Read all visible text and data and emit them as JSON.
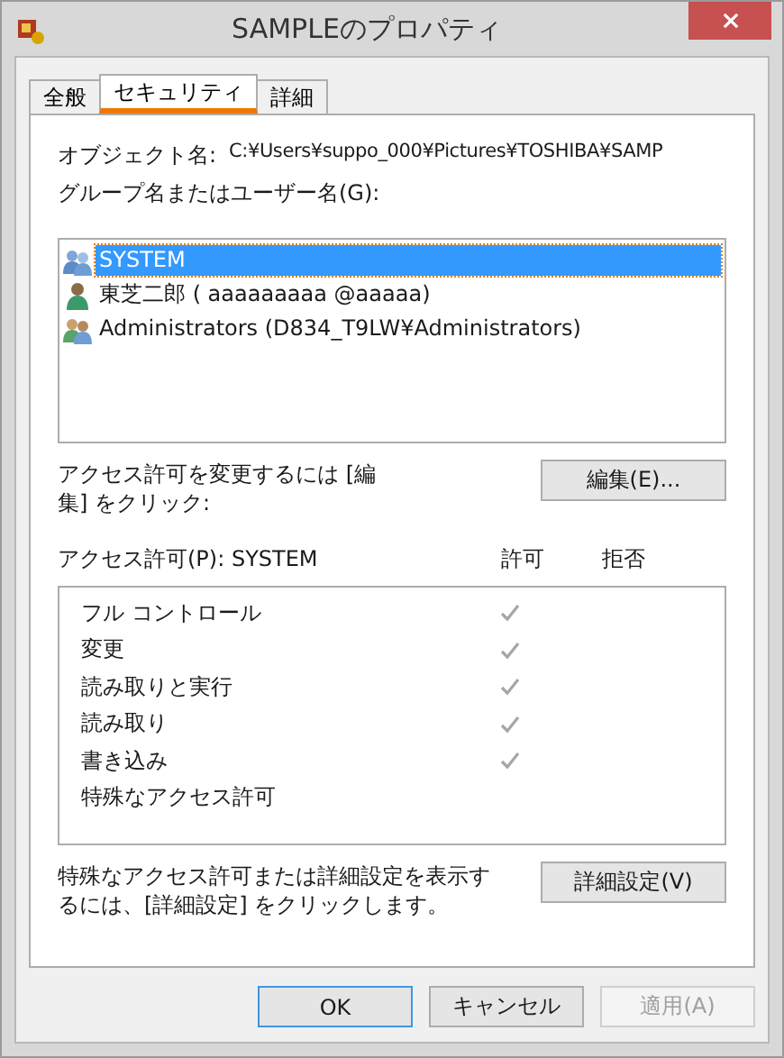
{
  "window": {
    "title": "SAMPLEのプロパティ"
  },
  "tabs": [
    {
      "label": "全般",
      "selected": false
    },
    {
      "label": "セキュリティ",
      "selected": true
    },
    {
      "label": "詳細",
      "selected": false
    }
  ],
  "object_name": {
    "label": "オブジェクト名:",
    "value": "C:¥Users¥suppo_000¥Pictures¥TOSHIBA¥SAMP"
  },
  "group_label": "グループ名またはユーザー名(G):",
  "users": [
    {
      "kind": "group",
      "name": "SYSTEM",
      "selected": true
    },
    {
      "kind": "user",
      "name": "東芝二郎 ( aaaaaaaaa @aaaaa)",
      "selected": false
    },
    {
      "kind": "admins",
      "name": "Administrators (D834_T9LW¥Administrators)",
      "selected": false
    }
  ],
  "edit_hint": "アクセス許可を変更するには [編集] をクリック:",
  "edit_button": "編集(E)...",
  "permissions_header": {
    "label": "アクセス許可(P): SYSTEM",
    "allow": "許可",
    "deny": "拒否"
  },
  "permissions": [
    {
      "name": "フル コントロール",
      "allow": true,
      "deny": false
    },
    {
      "name": "変更",
      "allow": true,
      "deny": false
    },
    {
      "name": "読み取りと実行",
      "allow": true,
      "deny": false
    },
    {
      "name": "読み取り",
      "allow": true,
      "deny": false
    },
    {
      "name": "書き込み",
      "allow": true,
      "deny": false
    },
    {
      "name": "特殊なアクセス許可",
      "allow": false,
      "deny": false
    }
  ],
  "advanced_hint": "特殊なアクセス許可または詳細設定を表示するには、[詳細設定] をクリックします。",
  "advanced_button": "詳細設定(V)",
  "buttons": [
    {
      "label": "OK",
      "kind": "default",
      "disabled": false
    },
    {
      "label": "キャンセル",
      "kind": "normal",
      "disabled": false
    },
    {
      "label": "適用(A)",
      "kind": "normal",
      "disabled": true
    }
  ]
}
